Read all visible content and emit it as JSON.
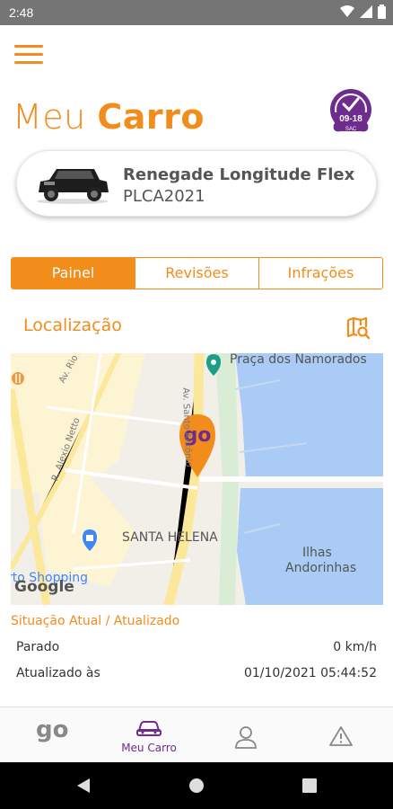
{
  "status_bar": {
    "time": "2:48"
  },
  "header": {
    "title_light": "Meu ",
    "title_bold": "Carro",
    "sac_badge": {
      "hours": "09-18",
      "label": "SAC"
    }
  },
  "vehicle": {
    "name": "Renegade Longitude Flex",
    "plate": "PLCA2021"
  },
  "tabs": [
    {
      "label": "Painel",
      "active": true
    },
    {
      "label": "Revisões",
      "active": false
    },
    {
      "label": "Infrações",
      "active": false
    }
  ],
  "location": {
    "title": "Localização",
    "map": {
      "labels": {
        "praca": "Praça dos Namorados",
        "santa_helena": "SANTA HELENA",
        "ilhas": "Ilhas",
        "andorinhas": "Andorinhas",
        "shopping": "rto Shopping",
        "av_rio_branco": "Av. Rio Branco",
        "alexio_netto": "R. Alexio Netto",
        "av_santo_antonio": "Av. Santo Antônio",
        "google": "Google",
        "marker_text": "go"
      }
    }
  },
  "situation": {
    "title": "Situação Atual / Atualizado",
    "status_label": "Parado",
    "speed": "0 km/h",
    "updated_label": "Atualizado às",
    "updated_value": "01/10/2021 05:44:52"
  },
  "bottom_nav": {
    "home_logo": "go",
    "my_car": "Meu Carro"
  },
  "colors": {
    "accent": "#f28c1b",
    "purple": "#6d2c8e",
    "water": "#a9cbf5",
    "map_bg": "#f2efe9",
    "road": "#fbe89a"
  }
}
